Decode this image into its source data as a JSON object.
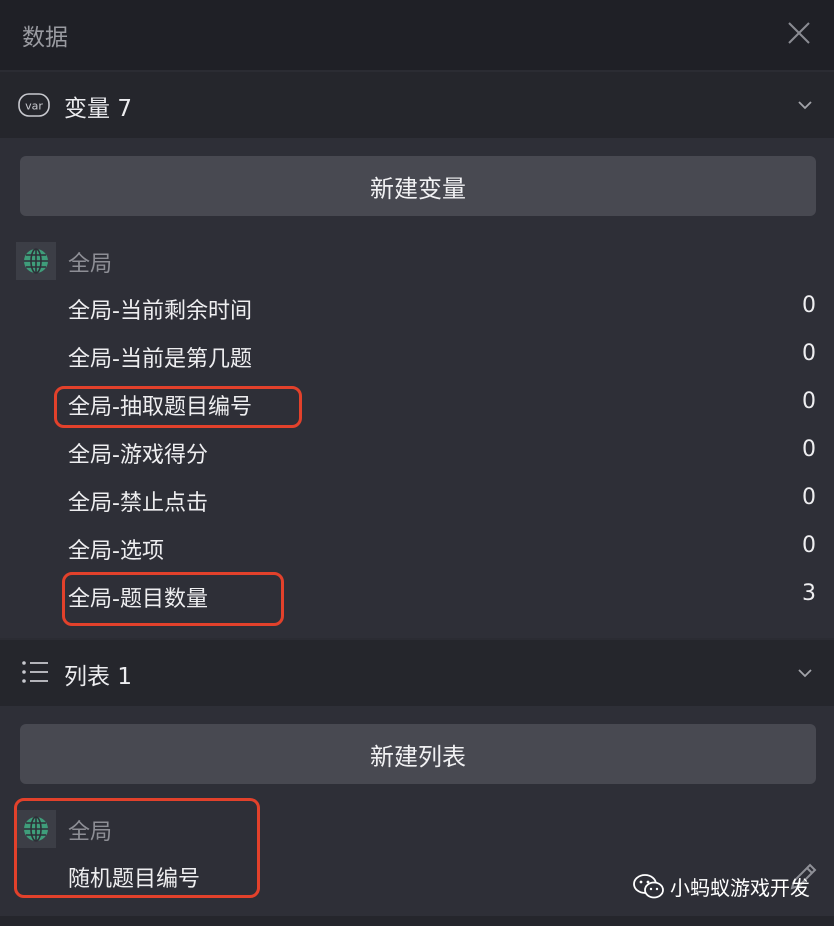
{
  "header": {
    "title": "数据"
  },
  "variables_section": {
    "label": "变量",
    "count": "7",
    "new_button": "新建变量",
    "group_label": "全局",
    "items": [
      {
        "name": "全局-当前剩余时间",
        "value": "0"
      },
      {
        "name": "全局-当前是第几题",
        "value": "0"
      },
      {
        "name": "全局-抽取题目编号",
        "value": "0"
      },
      {
        "name": "全局-游戏得分",
        "value": "0"
      },
      {
        "name": "全局-禁止点击",
        "value": "0"
      },
      {
        "name": "全局-选项",
        "value": "0"
      },
      {
        "name": "全局-题目数量",
        "value": "3"
      }
    ]
  },
  "lists_section": {
    "label": "列表",
    "count": "1",
    "new_button": "新建列表",
    "group_label": "全局",
    "items": [
      {
        "name": "随机题目编号"
      }
    ]
  },
  "watermark": {
    "text": "小蚂蚁游戏开发"
  },
  "icons": {
    "variables": "var-badge-icon",
    "lists": "list-icon",
    "group": "globe-icon",
    "close": "close-icon",
    "collapse": "chevron-down-icon",
    "edit": "pencil-icon",
    "watermark": "wechat-icon"
  },
  "colors": {
    "highlight": "#e2412b",
    "globe": "#3f9d7a",
    "button": "#484951",
    "panel": "#2e2f37",
    "header": "#25262c"
  }
}
